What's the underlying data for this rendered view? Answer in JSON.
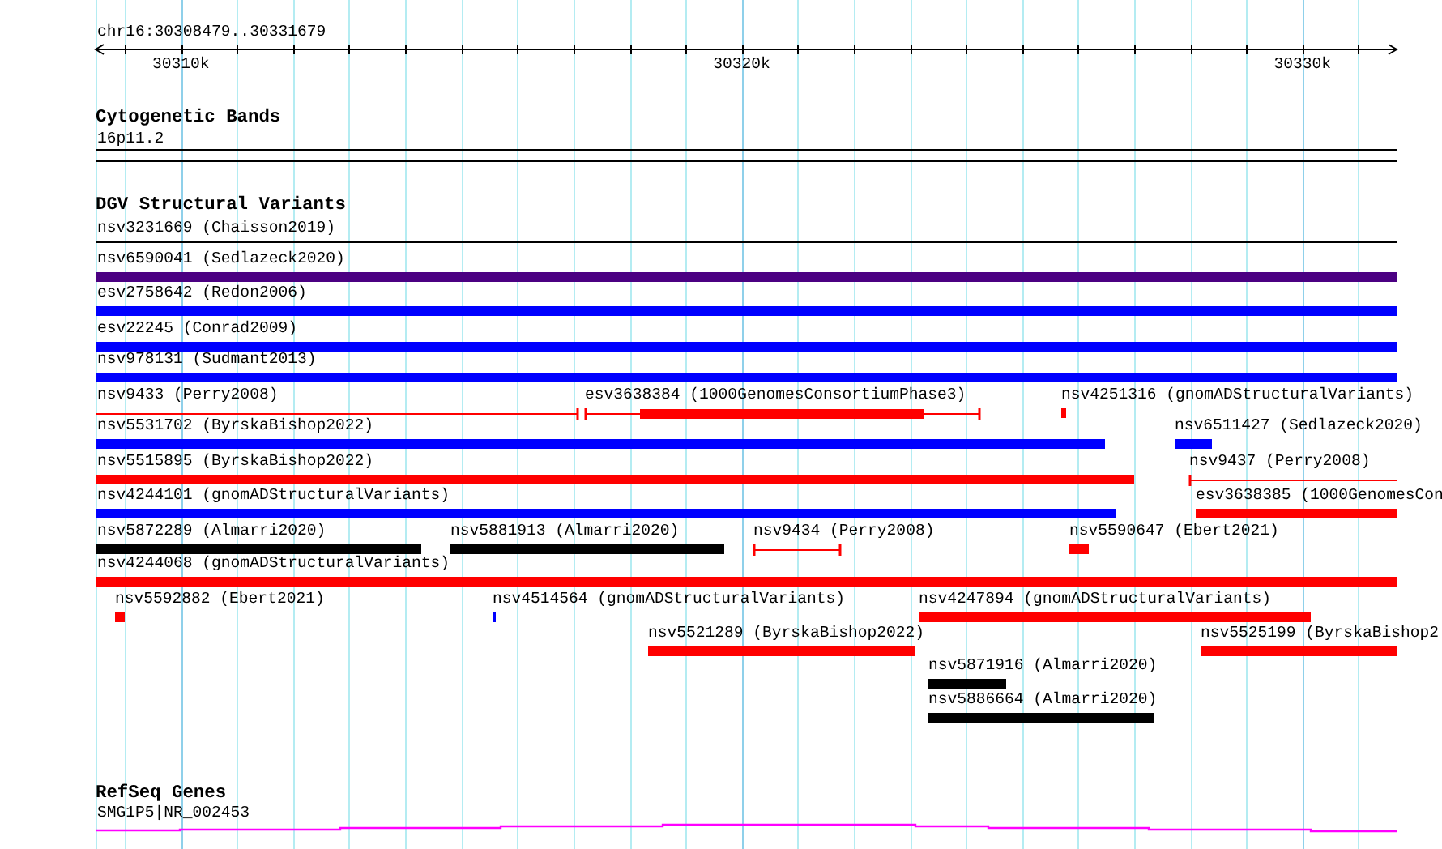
{
  "ruler": {
    "location": "chr16:30308479..30331679",
    "tick_labels": [
      "30310k",
      "30320k",
      "30330k"
    ]
  },
  "tracks": [
    {
      "kind": "cytoband",
      "title": "Cytogenetic Bands",
      "features": [
        {
          "label": "16p11.2"
        }
      ]
    },
    {
      "kind": "variants",
      "title": "DGV Structural Variants",
      "rows": [
        [
          {
            "label": "nsv3231669 (Chaisson2019)",
            "kind": "thin",
            "color": "#000000"
          }
        ],
        [
          {
            "label": "nsv6590041 (Sedlazeck2020)",
            "kind": "bar",
            "color": "#4b0082"
          }
        ],
        [
          {
            "label": "esv2758642 (Redon2006)",
            "kind": "bar",
            "color": "#0000ff"
          }
        ],
        [
          {
            "label": "esv22245 (Conrad2009)",
            "kind": "bar",
            "color": "#0000ff"
          }
        ],
        [
          {
            "label": "nsv978131 (Sudmant2013)",
            "kind": "bar",
            "color": "#0000ff"
          }
        ],
        [
          {
            "label": "nsv9433 (Perry2008)",
            "kind": "line",
            "color": "#ff0000"
          },
          {
            "label": "esv3638384 (1000GenomesConsortiumPhase3)",
            "kind": "split",
            "color": "#ff0000"
          },
          {
            "label": "nsv4251316 (gnomADStructuralVariants)",
            "kind": "bar",
            "color": "#ff0000"
          }
        ],
        [
          {
            "label": "nsv5531702 (ByrskaBishop2022)",
            "kind": "bar",
            "color": "#0000ff"
          },
          {
            "label": "nsv6511427 (Sedlazeck2020)",
            "kind": "bar",
            "color": "#0000ff"
          }
        ],
        [
          {
            "label": "nsv5515895 (ByrskaBishop2022)",
            "kind": "bar",
            "color": "#ff0000"
          },
          {
            "label": "nsv9437 (Perry2008)",
            "kind": "line",
            "color": "#ff0000"
          }
        ],
        [
          {
            "label": "nsv4244101 (gnomADStructuralVariants)",
            "kind": "bar",
            "color": "#0000ff"
          },
          {
            "label": "esv3638385 (1000GenomesCon",
            "kind": "bar",
            "color": "#ff0000"
          }
        ],
        [
          {
            "label": "nsv5872289 (Almarri2020)",
            "kind": "bar",
            "color": "#000000"
          },
          {
            "label": "nsv5881913 (Almarri2020)",
            "kind": "bar",
            "color": "#000000"
          },
          {
            "label": "nsv9434 (Perry2008)",
            "kind": "line",
            "color": "#ff0000"
          },
          {
            "label": "nsv5590647 (Ebert2021)",
            "kind": "bar",
            "color": "#ff0000"
          }
        ],
        [
          {
            "label": "nsv4244068 (gnomADStructuralVariants)",
            "kind": "bar",
            "color": "#ff0000"
          }
        ],
        [
          {
            "label": "nsv5592882 (Ebert2021)",
            "kind": "bar",
            "color": "#ff0000"
          },
          {
            "label": "nsv4514564 (gnomADStructuralVariants)",
            "kind": "bar",
            "color": "#0000ff"
          },
          {
            "label": "nsv4247894 (gnomADStructuralVariants)",
            "kind": "bar",
            "color": "#ff0000"
          }
        ],
        [
          {
            "label": "nsv5521289 (ByrskaBishop2022)",
            "kind": "bar",
            "color": "#ff0000"
          },
          {
            "label": "nsv5525199 (ByrskaBishop2",
            "kind": "bar",
            "color": "#ff0000"
          }
        ],
        [
          {
            "label": "nsv5871916 (Almarri2020)",
            "kind": "bar",
            "color": "#000000"
          }
        ],
        [
          {
            "label": "nsv5886664 (Almarri2020)",
            "kind": "bar",
            "color": "#000000"
          }
        ]
      ]
    },
    {
      "kind": "genes",
      "title": "RefSeq Genes",
      "features": [
        {
          "label": "SMG1P5|NR_002453"
        }
      ]
    }
  ]
}
